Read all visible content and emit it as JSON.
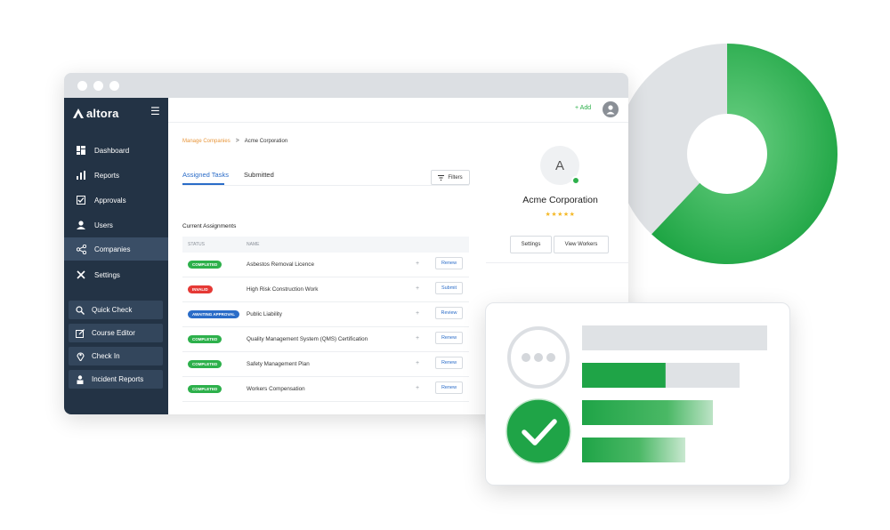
{
  "colors": {
    "brand_green": "#2db04b",
    "sidebar_bg": "#233345",
    "accent_blue": "#2a6cc8",
    "link_orange": "#e8963b",
    "invalid_red": "#e53935"
  },
  "donut": {
    "green_fraction": 0.62
  },
  "sidebar": {
    "brand": "altora",
    "menu_icon": "hamburger-icon",
    "items": [
      {
        "label": "Dashboard",
        "icon": "dashboard-icon"
      },
      {
        "label": "Reports",
        "icon": "bar-chart-icon"
      },
      {
        "label": "Approvals",
        "icon": "checkbox-icon"
      },
      {
        "label": "Users",
        "icon": "user-icon"
      },
      {
        "label": "Companies",
        "icon": "share-icon",
        "active": true
      },
      {
        "label": "Settings",
        "icon": "tools-icon"
      }
    ],
    "quick": [
      {
        "label": "Quick Check",
        "icon": "magnifier-icon"
      },
      {
        "label": "Course Editor",
        "icon": "edit-icon"
      },
      {
        "label": "Check In",
        "icon": "location-pin-icon"
      },
      {
        "label": "Incident Reports",
        "icon": "report-icon"
      }
    ]
  },
  "header": {
    "add_label": "+ Add"
  },
  "breadcrumb": {
    "parent": "Manage Companies",
    "separator": ">",
    "current": "Acme Corporation"
  },
  "tabs": [
    {
      "label": "Assigned Tasks",
      "active": true
    },
    {
      "label": "Submitted"
    }
  ],
  "filters_label": "Filters",
  "assignments": {
    "title": "Current Assignments",
    "columns": [
      "STATUS",
      "NAME"
    ],
    "rows": [
      {
        "status": "COMPLETED",
        "status_color": "#2db04b",
        "name": "Asbestos Removal Licence",
        "action": "Renew"
      },
      {
        "status": "INVALID",
        "status_color": "#e53935",
        "name": "High Risk Construction Work",
        "action": "Submit"
      },
      {
        "status": "AWAITING APPROVAL",
        "status_color": "#2a6cc8",
        "name": "Public Liability",
        "action": "Review"
      },
      {
        "status": "COMPLETED",
        "status_color": "#2db04b",
        "name": "Quality Management System (QMS) Certification",
        "action": "Renew"
      },
      {
        "status": "COMPLETED",
        "status_color": "#2db04b",
        "name": "Safety Management Plan",
        "action": "Renew"
      },
      {
        "status": "COMPLETED",
        "status_color": "#2db04b",
        "name": "Workers Compensation",
        "action": "Renew"
      }
    ]
  },
  "profile": {
    "initial": "A",
    "name": "Acme Corporation",
    "stars": "★★★★★",
    "rating": 5,
    "settings_label": "Settings",
    "view_workers_label": "View Workers"
  },
  "card": {
    "progress_bar_fraction": 0.53
  }
}
